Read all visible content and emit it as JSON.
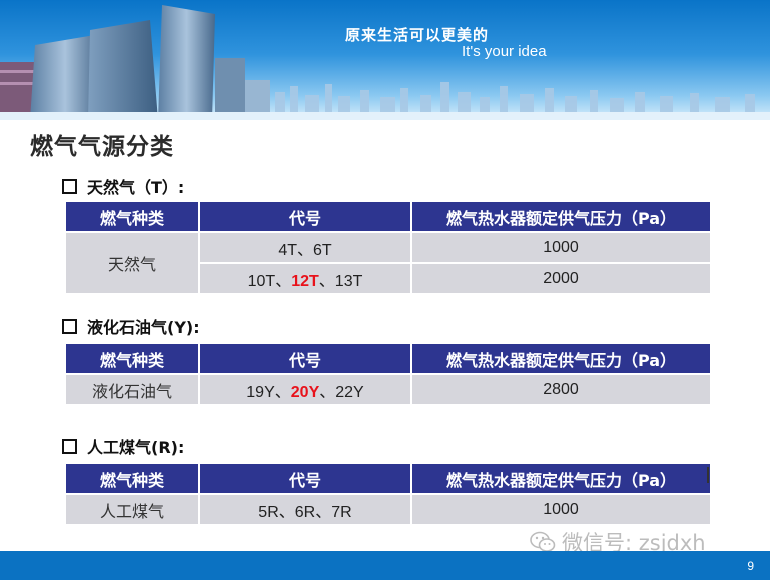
{
  "banner": {
    "line1": "原来生活可以更美的",
    "line2": "It's your idea"
  },
  "page_title": "燃气气源分类",
  "sections": [
    {
      "heading": "天然气（T）:",
      "headers": [
        "燃气种类",
        "代号",
        "燃气热水器额定供气压力（Pa）"
      ],
      "category": "天然气",
      "rows": [
        {
          "codes": [
            "4T",
            "、",
            "6T"
          ],
          "highlight_index": -1,
          "pressure": "1000"
        },
        {
          "codes": [
            "10T",
            "、",
            "12T",
            "、",
            "13T"
          ],
          "highlight_index": 2,
          "pressure": "2000"
        }
      ]
    },
    {
      "heading": "液化石油气(Y):",
      "headers": [
        "燃气种类",
        "代号",
        "燃气热水器额定供气压力（Pa）"
      ],
      "category": "液化石油气",
      "rows": [
        {
          "codes": [
            "19Y",
            "、",
            "20Y",
            "、",
            "22Y"
          ],
          "highlight_index": 2,
          "pressure": "2800"
        }
      ]
    },
    {
      "heading": "人工煤气(R):",
      "headers": [
        "燃气种类",
        "代号",
        "燃气热水器额定供气压力（Pa）"
      ],
      "category": "人工煤气",
      "rows": [
        {
          "codes": [
            "5R",
            "、",
            "6R",
            "、",
            "7R"
          ],
          "highlight_index": -1,
          "pressure": "1000"
        }
      ]
    }
  ],
  "watermark": "微信号: zsjdxh",
  "page_number": "9",
  "colors": {
    "header_bg": "#2d3590",
    "cell_bg": "#d6d6dc",
    "highlight": "#e8121b",
    "bottom_bar": "#0b72c2"
  }
}
